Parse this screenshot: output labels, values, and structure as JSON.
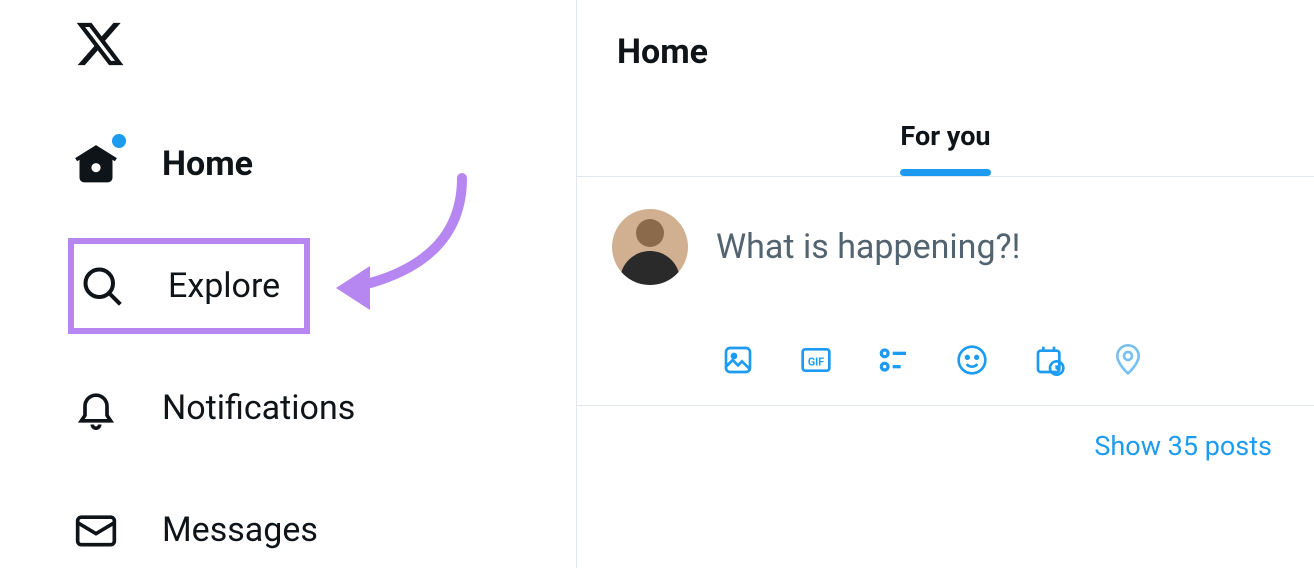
{
  "sidebar": {
    "items": [
      {
        "label": "Home",
        "icon": "home-icon",
        "active": true,
        "has_dot": true
      },
      {
        "label": "Explore",
        "icon": "search-icon",
        "active": false,
        "highlighted": true
      },
      {
        "label": "Notifications",
        "icon": "bell-icon",
        "active": false
      },
      {
        "label": "Messages",
        "icon": "envelope-icon",
        "active": false
      }
    ]
  },
  "header": {
    "title": "Home"
  },
  "tabs": [
    {
      "label": "For you",
      "active": true
    }
  ],
  "compose": {
    "placeholder": "What is happening?!"
  },
  "toolbar_icons": [
    "media-icon",
    "gif-icon",
    "poll-icon",
    "emoji-icon",
    "schedule-icon",
    "location-icon"
  ],
  "show_posts": {
    "text": "Show 35 posts"
  },
  "colors": {
    "accent": "#1d9bf0",
    "highlight_border": "#b687f0",
    "text_primary": "#0f1419",
    "text_secondary": "#536471"
  }
}
